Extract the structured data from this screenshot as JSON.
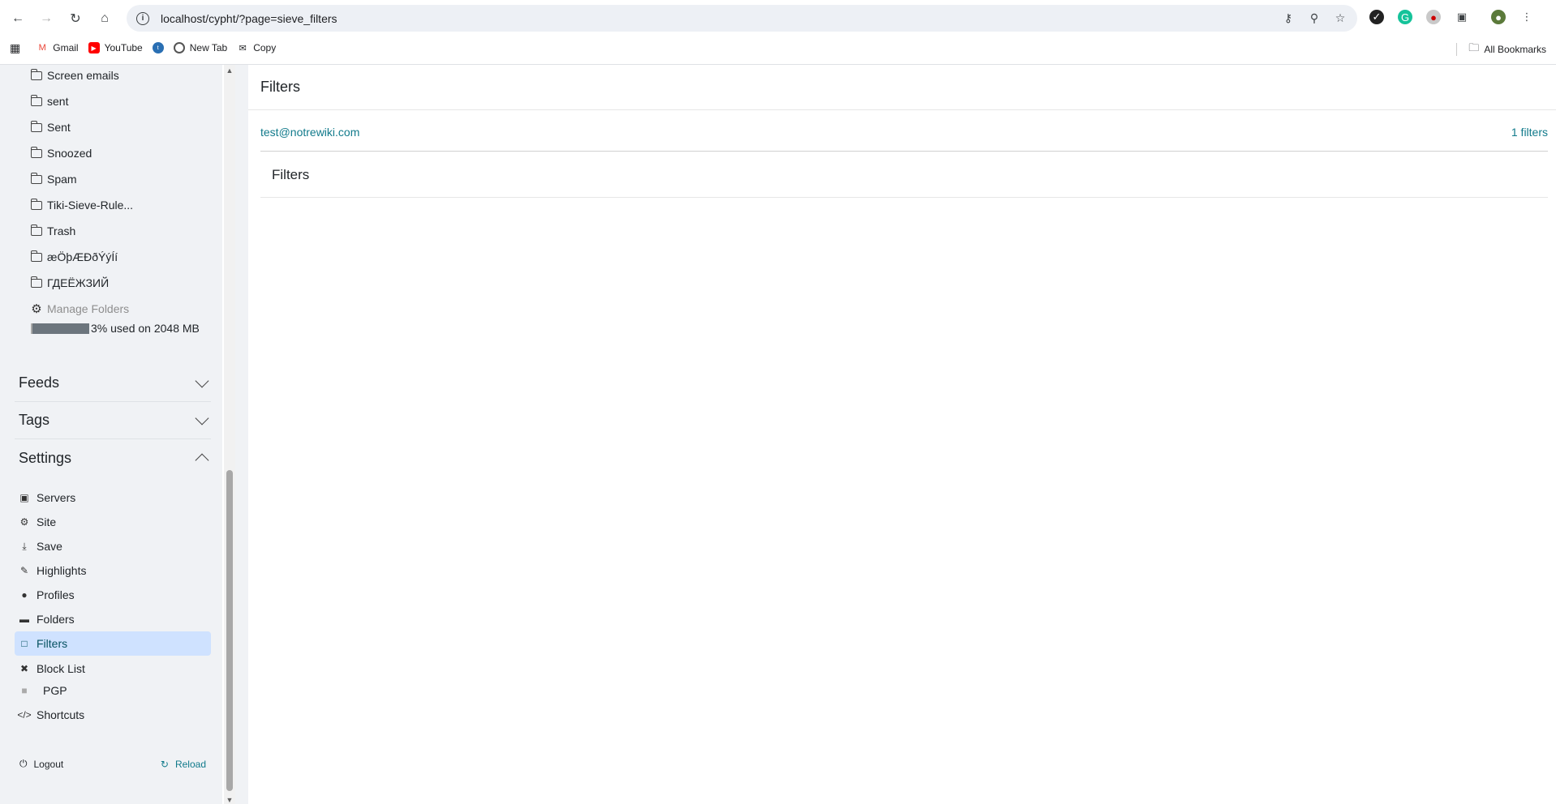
{
  "browser": {
    "url": "localhost/cypht/?page=sieve_filters",
    "bookmarks": [
      {
        "label": "Gmail",
        "icon": "gmail-icon"
      },
      {
        "label": "YouTube",
        "icon": "youtube-icon"
      },
      {
        "label": "",
        "icon": "site-icon"
      },
      {
        "label": "New Tab",
        "icon": "chrome-icon"
      },
      {
        "label": "Copy",
        "icon": "mail-icon"
      }
    ],
    "all_bookmarks": "All Bookmarks"
  },
  "sidebar": {
    "folders": [
      "Screen emails",
      "sent",
      "Sent",
      "Snoozed",
      "Spam",
      "Tiki-Sieve-Rule...",
      "Trash",
      "æÖþÆÐðÝýÍí",
      "ГДЕЁЖЗИЙ"
    ],
    "manage_folders": "Manage Folders",
    "quota_text": "3% used on 2048 MB",
    "quota_percent": 3,
    "sections": {
      "feeds": "Feeds",
      "tags": "Tags",
      "settings": "Settings"
    },
    "settings_items": [
      {
        "label": "Servers",
        "icon": "server-icon"
      },
      {
        "label": "Site",
        "icon": "gear-icon"
      },
      {
        "label": "Save",
        "icon": "download-icon"
      },
      {
        "label": "Highlights",
        "icon": "pencil-icon"
      },
      {
        "label": "Profiles",
        "icon": "person-icon"
      },
      {
        "label": "Folders",
        "icon": "folder-icon"
      },
      {
        "label": "Filters",
        "icon": "bookmark-icon"
      },
      {
        "label": "Block List",
        "icon": "x-circle-icon"
      },
      {
        "label": "PGP",
        "icon": "lock-icon"
      },
      {
        "label": "Shortcuts",
        "icon": "code-icon"
      }
    ],
    "logout": "Logout",
    "reload": "Reload"
  },
  "main": {
    "title": "Filters",
    "account": "test@notrewiki.com",
    "filter_count": "1 filters",
    "subheading": "Filters"
  },
  "colors": {
    "accent": "#117a8b",
    "active_bg": "#cfe2ff",
    "sidebar_bg": "#f0f2f5"
  }
}
